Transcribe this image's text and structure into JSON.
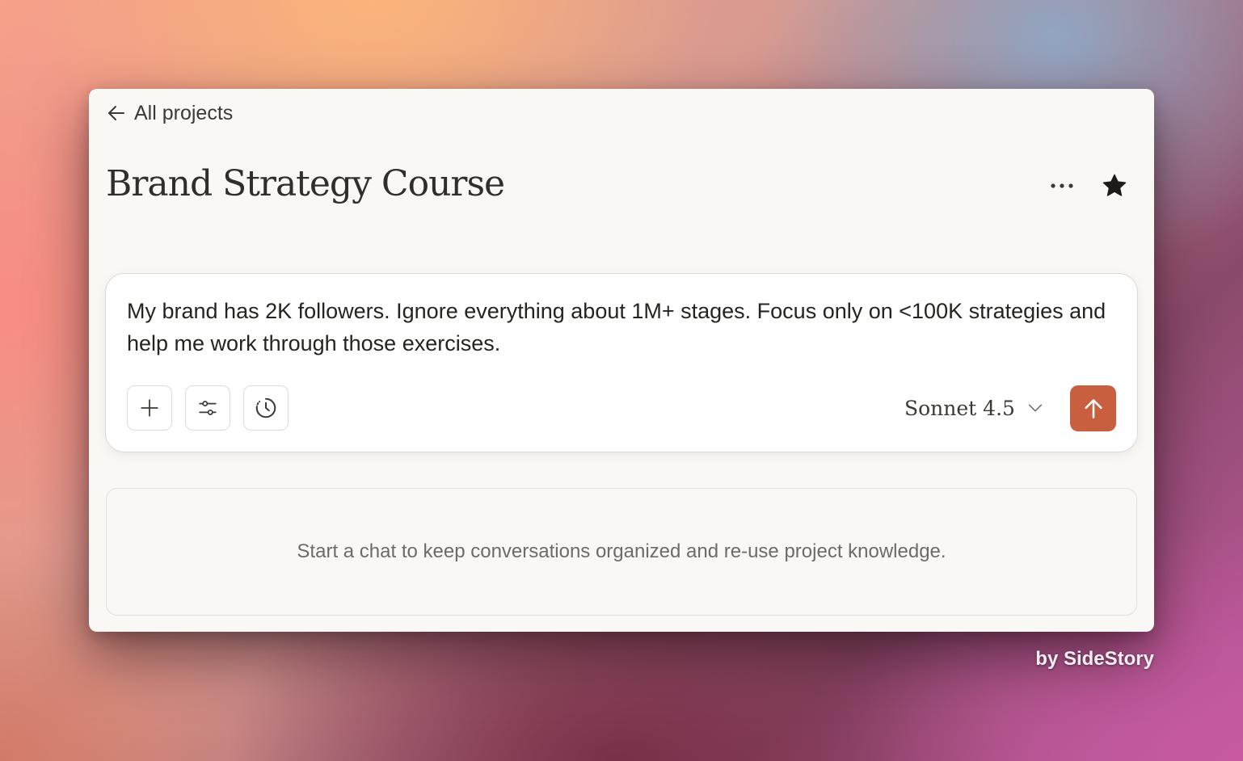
{
  "nav": {
    "back_label": "All projects",
    "back_icon": "arrow-left-icon"
  },
  "header": {
    "title": "Brand Strategy Course",
    "more_icon": "more-horizontal-icon",
    "star_icon": "star-filled-icon"
  },
  "composer": {
    "message": "My brand has 2K followers. Ignore everything about 1M+ stages. Focus only on <100K strategies and help me work through those exercises.",
    "tools": [
      {
        "icon": "plus-icon"
      },
      {
        "icon": "sliders-icon"
      },
      {
        "icon": "history-clock-icon"
      }
    ],
    "model": "Sonnet 4.5",
    "model_icon": "chevron-down-icon",
    "send_icon": "arrow-up-icon",
    "send_color": "#c8603f"
  },
  "empty_state": {
    "text": "Start a chat to keep conversations organized and re-use project knowledge."
  },
  "watermark": {
    "text": "by SideStory"
  }
}
